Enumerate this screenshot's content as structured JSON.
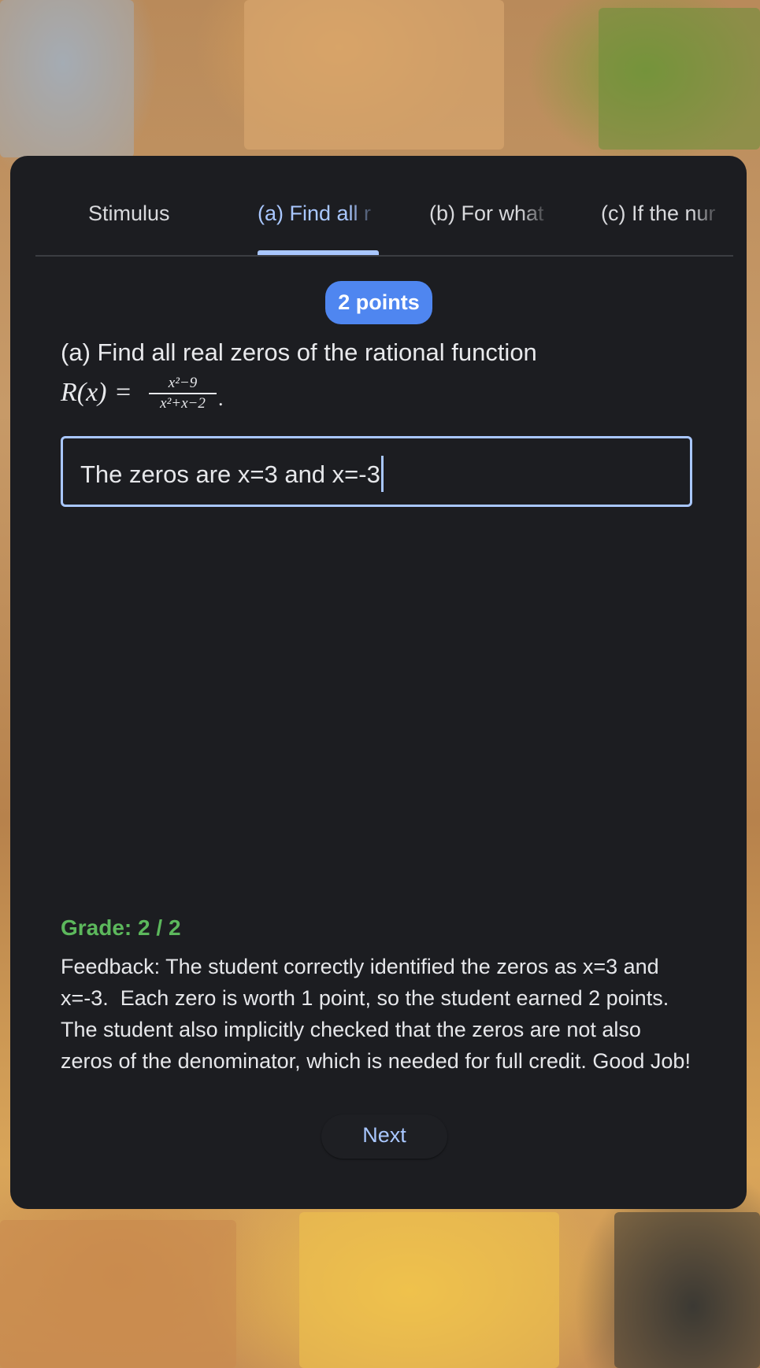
{
  "tabs": [
    {
      "label": "Stimulus"
    },
    {
      "label": "(a) Find all r"
    },
    {
      "label": "(b) For what"
    },
    {
      "label": "(c) If the nur"
    }
  ],
  "active_tab_index": 1,
  "points_badge": "2 points",
  "question": {
    "text": "(a) Find all real zeros of the rational function",
    "formula": {
      "lhs": "R(x)",
      "eq": "=",
      "numerator": "x²−9",
      "denominator": "x²+x−2",
      "end": "."
    }
  },
  "answer": {
    "value": "The zeros are x=3 and x=-3"
  },
  "grade": "Grade: 2 / 2",
  "feedback": "Feedback: The student correctly identified the zeros as x=3 and x=-3.  Each zero is worth 1 point, so the student earned 2 points.  The student also implicitly checked that the zeros are not also zeros of the denominator, which is needed for full credit. Good Job!",
  "next_button": "Next",
  "colors": {
    "card_background": "#1c1d21",
    "accent": "#a9c7ff",
    "badge": "#4f86f0",
    "grade": "#5cb85c"
  }
}
